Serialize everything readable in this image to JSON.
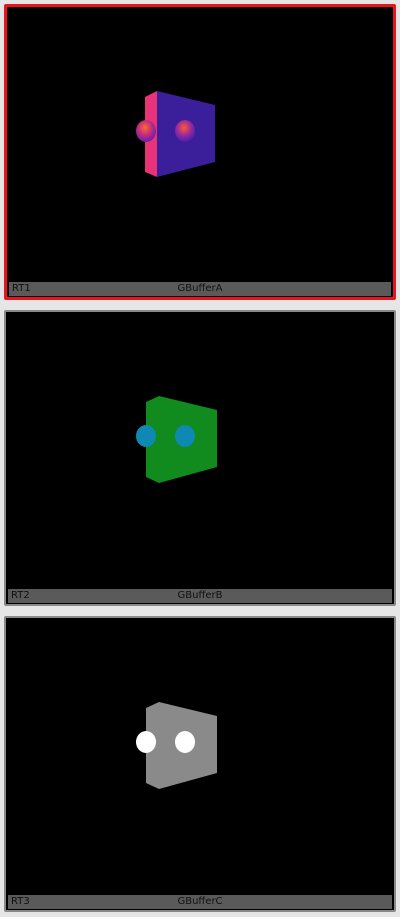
{
  "panels": [
    {
      "rt": "RT1",
      "buffer": "GBufferA",
      "selected": true,
      "colors": {
        "side": "#e8327a",
        "front": "#3a1e9a",
        "sphere_a": "#c02a86",
        "sphere_b": "#6a2ab0",
        "highlight": "#ff5a3a"
      }
    },
    {
      "rt": "RT2",
      "buffer": "GBufferB",
      "selected": false,
      "colors": {
        "side": "#0e8a1c",
        "front": "#118a1e",
        "sphere_a": "#0e89b4",
        "sphere_b": "#0e89b4"
      }
    },
    {
      "rt": "RT3",
      "buffer": "GBufferC",
      "selected": false,
      "colors": {
        "side": "#8a8a8a",
        "front": "#8a8a8a",
        "sphere_a": "#ffffff",
        "sphere_b": "#ffffff"
      }
    }
  ],
  "theme": {
    "selection_border": "#e8161c",
    "statusbar_bg": "#5a5a5a",
    "background": "#e6e6e6"
  }
}
